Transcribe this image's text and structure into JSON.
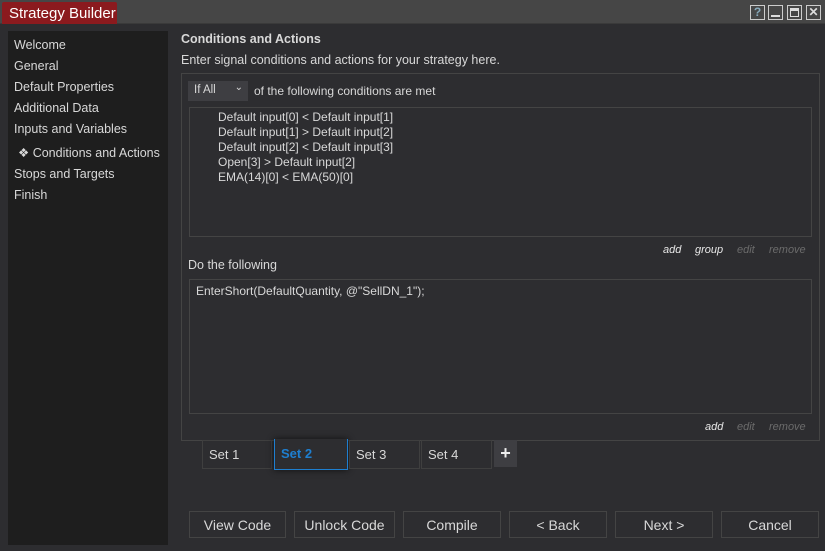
{
  "window": {
    "title": "Strategy Builder",
    "help": "?",
    "minimize": "_",
    "maximize": "□",
    "close": "✕"
  },
  "sidebar": {
    "items": [
      {
        "label": "Welcome"
      },
      {
        "label": "General"
      },
      {
        "label": "Default Properties"
      },
      {
        "label": "Additional Data"
      },
      {
        "label": "Inputs and Variables"
      },
      {
        "label": "Conditions and Actions",
        "active": true,
        "marker": "❖"
      },
      {
        "label": "Stops and Targets"
      },
      {
        "label": "Finish"
      }
    ]
  },
  "main": {
    "heading": "Conditions and Actions",
    "subtitle": "Enter signal conditions and actions for your strategy here.",
    "condition_mode": "If All",
    "condition_mode_suffix": "of the following conditions are met",
    "conditions": [
      "Default input[0] < Default input[1]",
      "Default input[1] > Default input[2]",
      "Default input[2] < Default input[3]",
      "Open[3] > Default input[2]",
      "EMA(14)[0] < EMA(50)[0]"
    ],
    "condition_links": {
      "add": "add",
      "group": "group",
      "edit": "edit",
      "remove": "remove"
    },
    "actions_label": "Do the following",
    "actions": [
      "EnterShort(DefaultQuantity, @\"SellDN_1\");"
    ],
    "action_links": {
      "add": "add",
      "edit": "edit",
      "remove": "remove"
    },
    "sets": [
      {
        "label": "Set 1"
      },
      {
        "label": "Set 2",
        "active": true
      },
      {
        "label": "Set 3"
      },
      {
        "label": "Set 4"
      }
    ],
    "add_set": "+"
  },
  "buttons": {
    "view_code": "View Code",
    "unlock_code": "Unlock Code",
    "compile": "Compile",
    "back": "< Back",
    "next": "Next >",
    "cancel": "Cancel"
  },
  "colors": {
    "title_bg": "#8b1a1e",
    "active_tab": "#1e7fd0"
  }
}
